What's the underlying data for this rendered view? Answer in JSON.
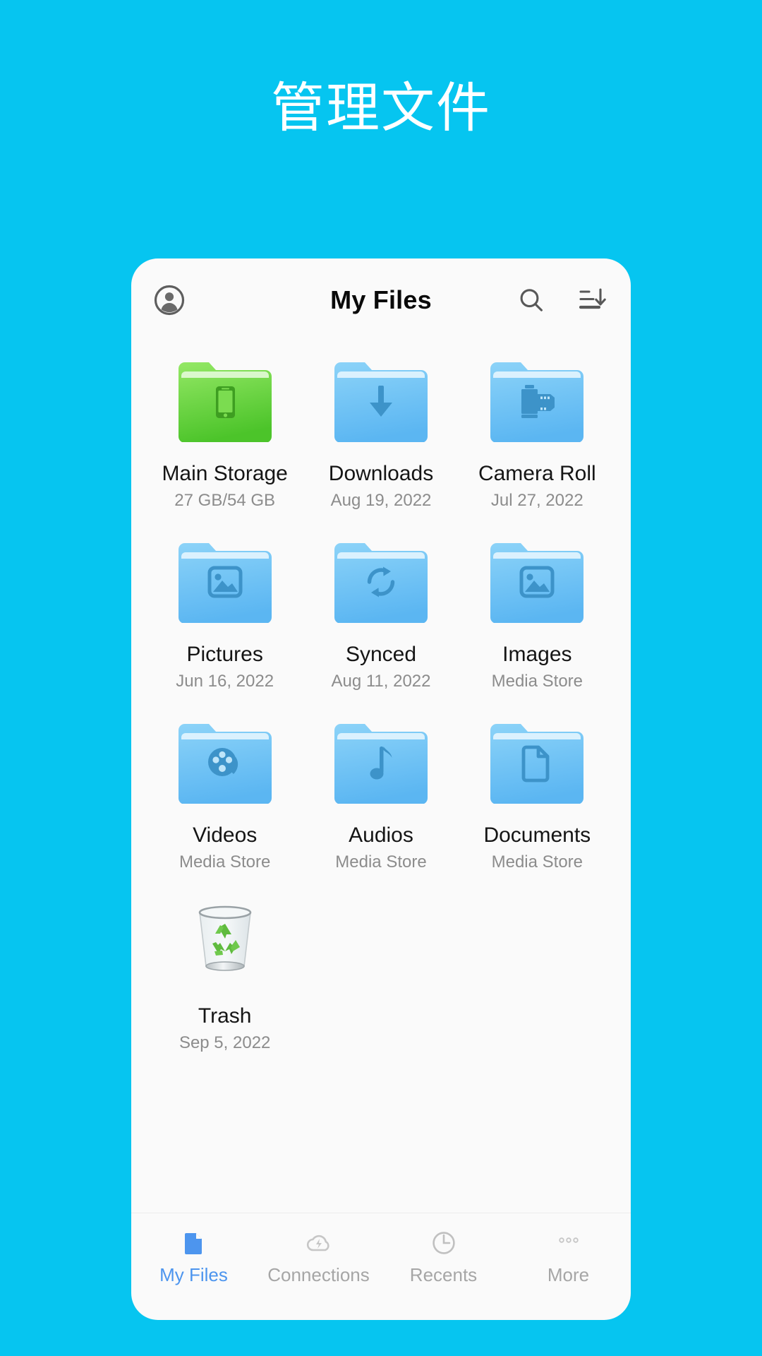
{
  "page": {
    "headline": "管理文件",
    "background_color": "#06C5F0"
  },
  "app": {
    "title": "My Files",
    "avatar_icon": "account-circle-icon",
    "search_icon": "search-icon",
    "sort_icon": "sort-descending-icon",
    "accent_color": "#4D95EE",
    "card_background": "#FAFAFA"
  },
  "files": {
    "items": [
      {
        "name": "Main Storage",
        "meta": "27 GB/54 GB",
        "icon": "folder-phone-icon",
        "folder_color": "green"
      },
      {
        "name": "Downloads",
        "meta": "Aug 19, 2022",
        "icon": "folder-download-icon",
        "folder_color": "blue"
      },
      {
        "name": "Camera Roll",
        "meta": "Jul 27, 2022",
        "icon": "folder-film-icon",
        "folder_color": "blue"
      },
      {
        "name": "Pictures",
        "meta": "Jun 16, 2022",
        "icon": "folder-image-icon",
        "folder_color": "blue"
      },
      {
        "name": "Synced",
        "meta": "Aug 11, 2022",
        "icon": "folder-sync-icon",
        "folder_color": "blue"
      },
      {
        "name": "Images",
        "meta": "Media Store",
        "icon": "folder-image-icon",
        "folder_color": "blue"
      },
      {
        "name": "Videos",
        "meta": "Media Store",
        "icon": "folder-video-icon",
        "folder_color": "blue"
      },
      {
        "name": "Audios",
        "meta": "Media Store",
        "icon": "folder-audio-icon",
        "folder_color": "blue"
      },
      {
        "name": "Documents",
        "meta": "Media Store",
        "icon": "folder-document-icon",
        "folder_color": "blue"
      },
      {
        "name": "Trash",
        "meta": "Sep 5, 2022",
        "icon": "recycle-bin-icon",
        "folder_color": "none"
      }
    ]
  },
  "bottom_nav": {
    "items": [
      {
        "label": "My Files",
        "icon": "document-icon",
        "active": true
      },
      {
        "label": "Connections",
        "icon": "cloud-bolt-icon",
        "active": false
      },
      {
        "label": "Recents",
        "icon": "clock-icon",
        "active": false
      },
      {
        "label": "More",
        "icon": "more-dots-icon",
        "active": false
      }
    ]
  }
}
